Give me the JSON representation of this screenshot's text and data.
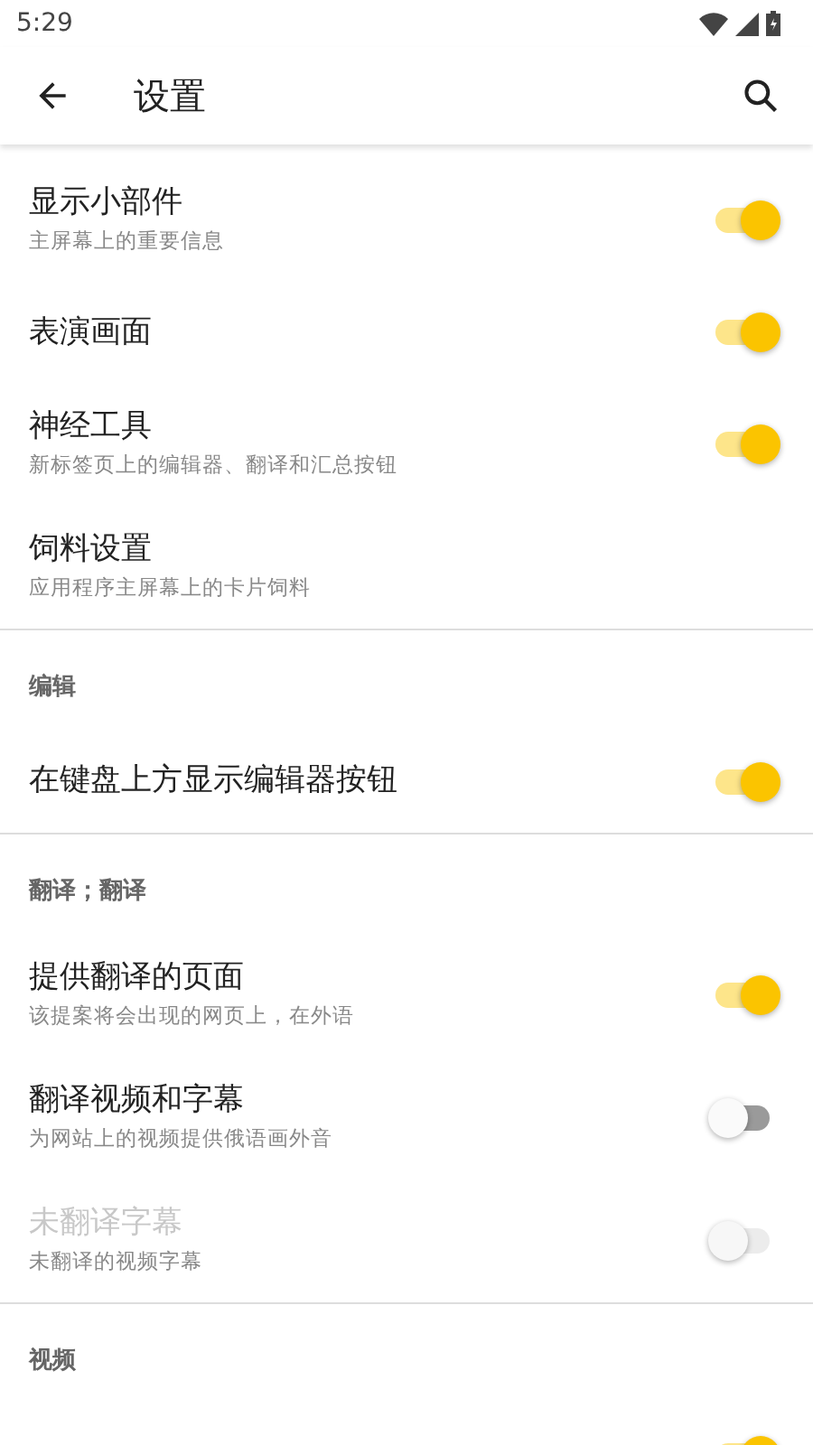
{
  "status_bar": {
    "time": "5:29"
  },
  "app_bar": {
    "title": "设置"
  },
  "sections": [
    {
      "items": [
        {
          "title": "显示小部件",
          "subtitle": "主屏幕上的重要信息",
          "kind": "switch",
          "on": true,
          "disabled": false
        },
        {
          "title": "表演画面",
          "kind": "switch",
          "on": true,
          "disabled": false
        },
        {
          "title": "神经工具",
          "subtitle": "新标签页上的编辑器、翻译和汇总按钮",
          "kind": "switch",
          "on": true,
          "disabled": false
        },
        {
          "title": "饲料设置",
          "subtitle": "应用程序主屏幕上的卡片饲料",
          "kind": "link",
          "disabled": false
        }
      ]
    },
    {
      "header": "编辑",
      "items": [
        {
          "title": "在键盘上方显示编辑器按钮",
          "kind": "switch",
          "on": true,
          "disabled": false
        }
      ]
    },
    {
      "header": "翻译；翻译",
      "items": [
        {
          "title": "提供翻译的页面",
          "subtitle": "该提案将会出现的网页上，在外语",
          "kind": "switch",
          "on": true,
          "disabled": false
        },
        {
          "title": "翻译视频和字幕",
          "subtitle": "为网站上的视频提供俄语画外音",
          "kind": "switch",
          "on": false,
          "disabled": false
        },
        {
          "title": "未翻译字幕",
          "subtitle": "未翻译的视频字幕",
          "kind": "switch",
          "on": false,
          "disabled": true
        }
      ]
    },
    {
      "header": "视频",
      "items": [
        {
          "kind": "switch",
          "on": true,
          "disabled": false
        }
      ]
    }
  ]
}
